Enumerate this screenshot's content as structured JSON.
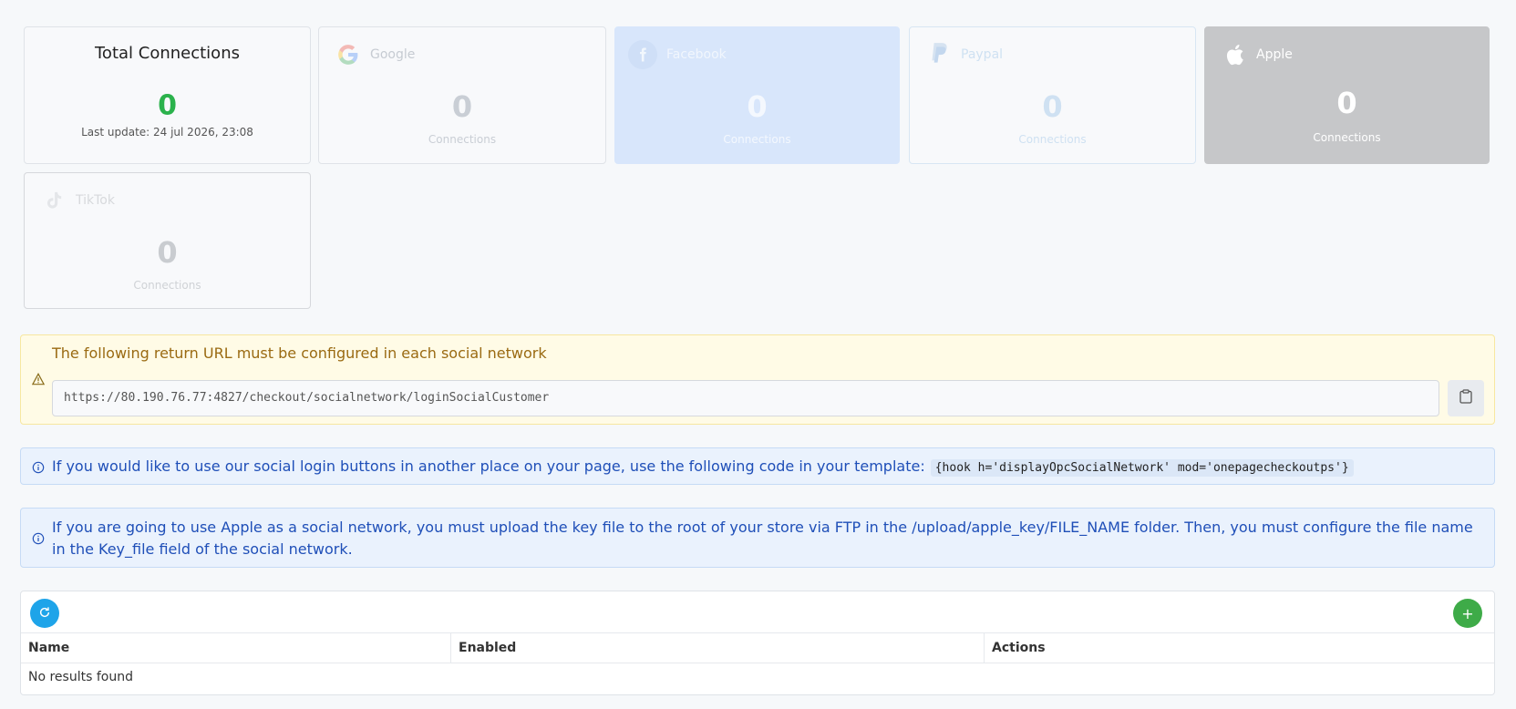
{
  "total": {
    "title": "Total Connections",
    "count": "0",
    "last_update": "Last update: 24 jul 2026, 23:08"
  },
  "networks": [
    {
      "id": "google",
      "name": "Google",
      "count": "0",
      "sub": "Connections",
      "icon": "google-icon"
    },
    {
      "id": "facebook",
      "name": "Facebook",
      "count": "0",
      "sub": "Connections",
      "icon": "facebook-icon",
      "color": "#d8e6fb"
    },
    {
      "id": "paypal",
      "name": "Paypal",
      "count": "0",
      "sub": "Connections",
      "icon": "paypal-icon"
    },
    {
      "id": "apple",
      "name": "Apple",
      "count": "0",
      "sub": "Connections",
      "icon": "apple-icon",
      "color": "#c6c7c9"
    },
    {
      "id": "tiktok",
      "name": "TikTok",
      "count": "0",
      "sub": "Connections",
      "icon": "tiktok-icon"
    }
  ],
  "warning": {
    "title": "The following return URL must be configured in each social network",
    "url": "https://80.190.76.77:4827/checkout/socialnetwork/loginSocialCustomer",
    "icon": "warning-icon",
    "copy_icon": "clipboard-icon"
  },
  "info_hook": {
    "text": "If you would like to use our social login buttons in another place on your page, use the following code in your template:",
    "code": "{hook h='displayOpcSocialNetwork' mod='onepagecheckoutps'}"
  },
  "info_apple": {
    "text": "If you are going to use Apple as a social network, you must upload the key file to the root of your store via FTP in the /upload/apple_key/FILE_NAME folder. Then, you must configure the file name in the Key_file field of the social network."
  },
  "table": {
    "columns": [
      "Name",
      "Enabled",
      "Actions"
    ],
    "empty_text": "No results found",
    "add_label": "+"
  },
  "colors": {
    "total_count": "#2bb24c",
    "refresh_button": "#1ea4e9",
    "add_button": "#3eab48",
    "info_text": "#1f4fb8",
    "warning_text": "#9a6a12"
  }
}
